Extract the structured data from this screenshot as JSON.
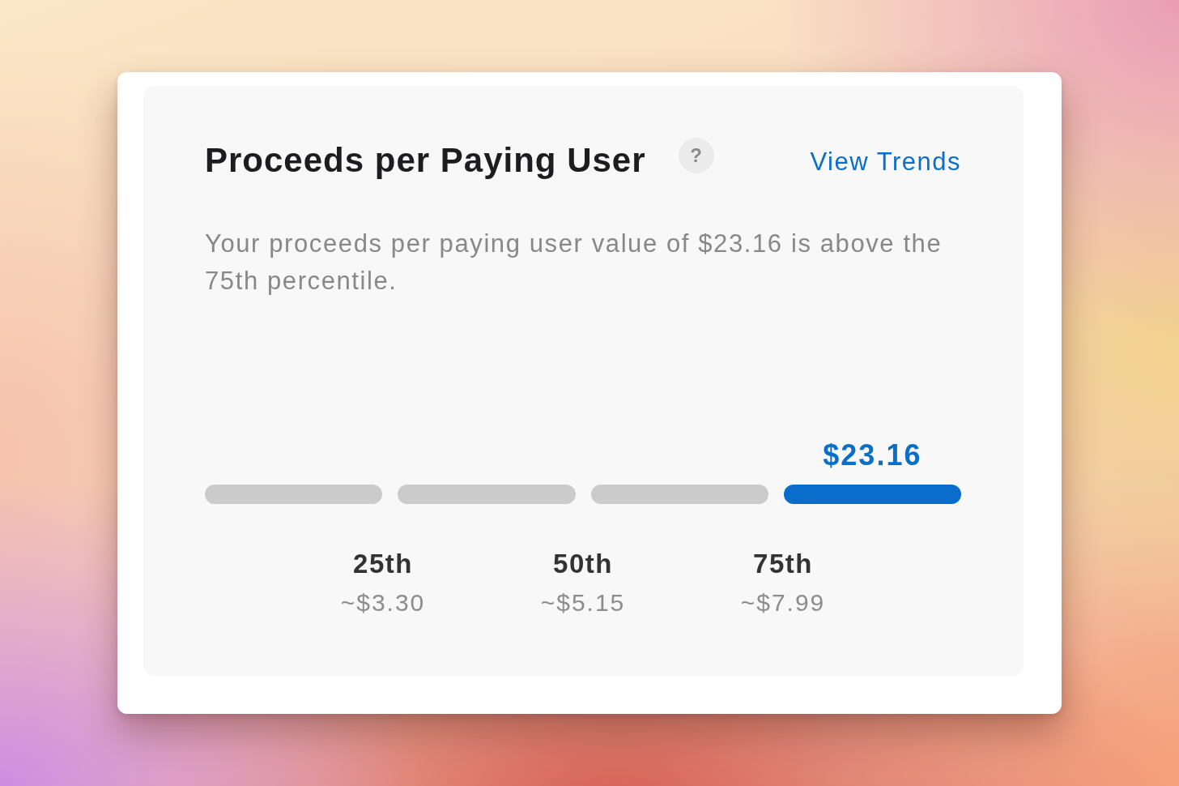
{
  "card": {
    "title": "Proceeds per Paying User",
    "help_button": "?",
    "link": "View Trends",
    "description": "Your proceeds per paying user value of $23.16 is above the 75th percentile."
  },
  "meter": {
    "value_label": "$23.16",
    "segments": [
      {
        "selected": false
      },
      {
        "selected": false
      },
      {
        "selected": false
      },
      {
        "selected": true
      }
    ]
  },
  "percentiles": [
    {
      "label": "25th",
      "value": "~$3.30"
    },
    {
      "label": "50th",
      "value": "~$5.15"
    },
    {
      "label": "75th",
      "value": "~$7.99"
    }
  ]
}
